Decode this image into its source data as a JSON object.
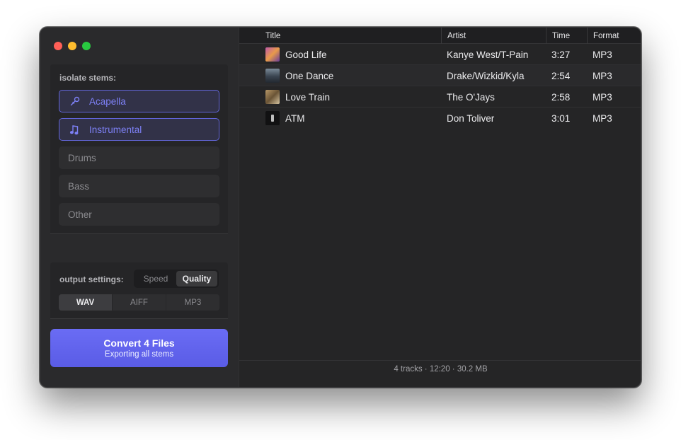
{
  "sidebar": {
    "stems_label": "isolate stems:",
    "stems": [
      {
        "label": "Acapella",
        "icon": "microphone-icon",
        "active": true
      },
      {
        "label": "Instrumental",
        "icon": "music-notes-icon",
        "active": true
      },
      {
        "label": "Drums",
        "active": false
      },
      {
        "label": "Bass",
        "active": false
      },
      {
        "label": "Other",
        "active": false
      }
    ],
    "output_label": "output settings:",
    "modes": [
      "Speed",
      "Quality"
    ],
    "selected_mode": "Quality",
    "formats": [
      "WAV",
      "AIFF",
      "MP3"
    ],
    "selected_format": "WAV",
    "convert_title": "Convert 4 Files",
    "convert_subtitle": "Exporting all stems"
  },
  "tracks": {
    "columns": [
      "Title",
      "Artist",
      "Time",
      "Format"
    ],
    "rows": [
      {
        "title": "Good Life",
        "artist": "Kanye West/T-Pain",
        "time": "3:27",
        "format": "MP3"
      },
      {
        "title": "One Dance",
        "artist": "Drake/Wizkid/Kyla",
        "time": "2:54",
        "format": "MP3"
      },
      {
        "title": "Love Train",
        "artist": "The O'Jays",
        "time": "2:58",
        "format": "MP3"
      },
      {
        "title": "ATM",
        "artist": "Don Toliver",
        "time": "3:01",
        "format": "MP3"
      }
    ],
    "footer": "4 tracks · 12:20 · 30.2 MB"
  },
  "colors": {
    "accent": "#6a6cf4",
    "active_text": "#7d80f5",
    "window_bg": "#252526"
  }
}
